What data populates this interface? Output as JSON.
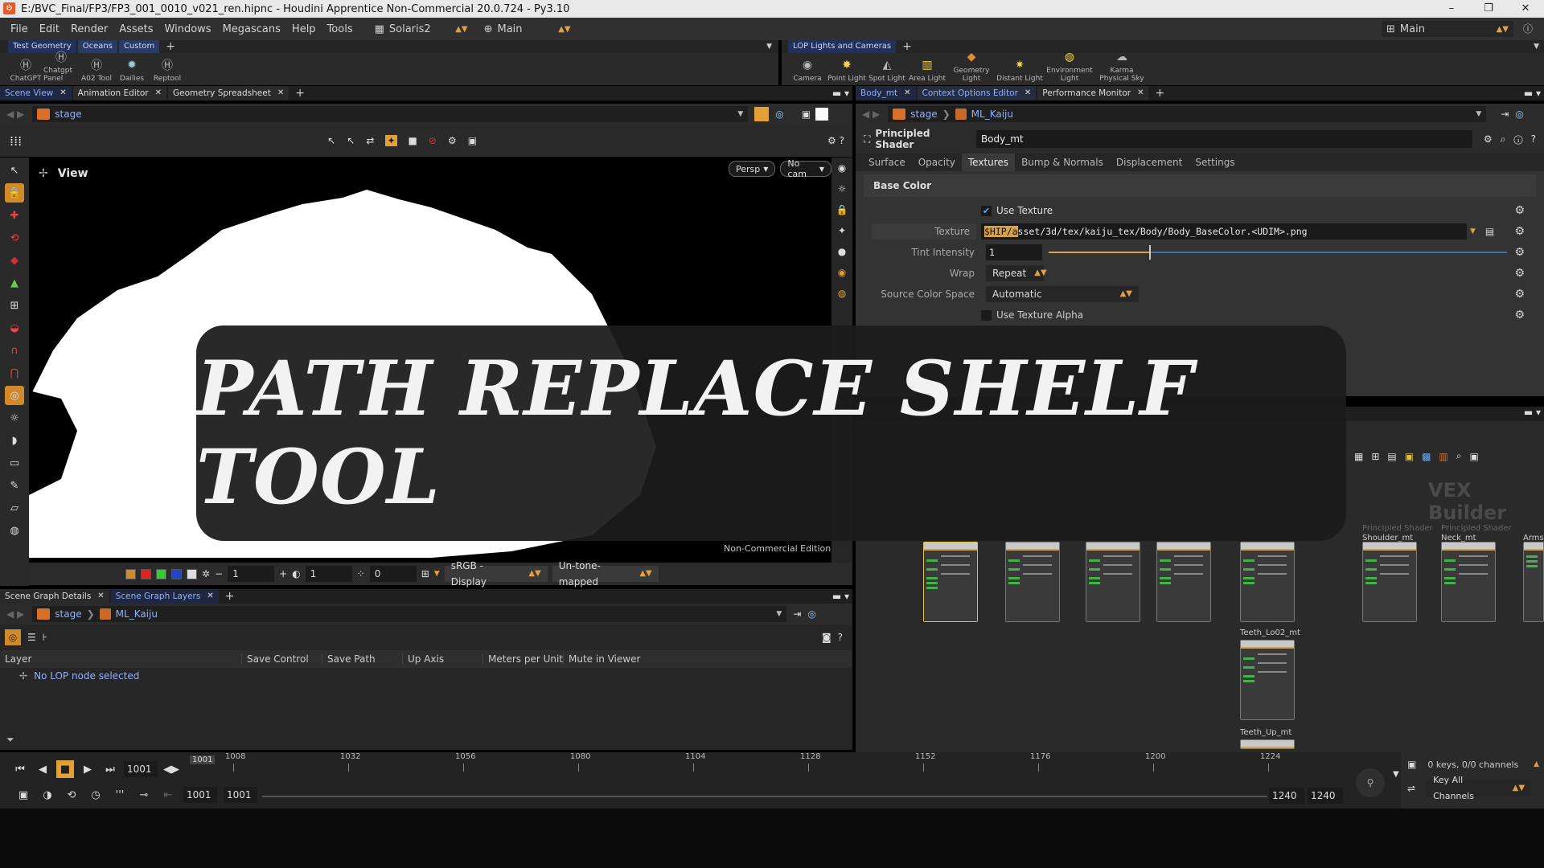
{
  "window": {
    "title": "E:/BVC_Final/FP3/FP3_001_0010_v021_ren.hipnc - Houdini Apprentice Non-Commercial 20.0.724 - Py3.10",
    "controls": [
      "–",
      "❐",
      "✕"
    ]
  },
  "menu": {
    "items": [
      "File",
      "Edit",
      "Render",
      "Assets",
      "Windows",
      "Megascans",
      "Help",
      "Tools"
    ],
    "desktop": "Solaris2",
    "workspace": "Main",
    "right_workspace": "Main"
  },
  "shelf_left": {
    "tabs": [
      "Test Geometry",
      "Oceans",
      "Custom"
    ],
    "tools": [
      "ChatGPT",
      "Chatgpt Panel",
      "A02 Tool",
      "Dailies",
      "Reptool"
    ]
  },
  "shelf_right": {
    "tabs": [
      "LOP Lights and Cameras"
    ],
    "tools": [
      "Camera",
      "Point Light",
      "Spot Light",
      "Area Light",
      "Geometry Light",
      "Distant Light",
      "Environment Light",
      "Karma Physical Sky"
    ]
  },
  "left_pane": {
    "tabs": [
      "Scene View",
      "Animation Editor",
      "Geometry Spreadsheet"
    ],
    "path": "stage",
    "view_label": "View",
    "persp_btn": "Persp",
    "cam_btn": "No cam",
    "watermark": "Non-Commercial Edition",
    "footer": {
      "a": "1",
      "b": "1",
      "c": "0",
      "colorspace": "sRGB - Display",
      "tonemap": "Un-tone-mapped"
    }
  },
  "overlay_title": "PATH REPLACE SHELF TOOL",
  "scene_graph": {
    "tabs": [
      "Scene Graph Details",
      "Scene Graph Layers"
    ],
    "path": [
      "stage",
      "ML_Kaiju"
    ],
    "columns": [
      "Layer",
      "Save Control",
      "Save Path",
      "Up Axis",
      "Meters per Unit",
      "Mute in Viewer"
    ],
    "message": "No LOP node selected"
  },
  "right_pane": {
    "tabs": [
      "Body_mt",
      "Context Options Editor",
      "Performance Monitor"
    ],
    "path": [
      "stage",
      "ML_Kaiju"
    ],
    "node_type": "Principled Shader",
    "node_name": "Body_mt",
    "param_tabs": [
      "Surface",
      "Opacity",
      "Textures",
      "Bump & Normals",
      "Displacement",
      "Settings"
    ],
    "active_tab": "Textures",
    "section": "Base Color",
    "use_texture": "Use Texture",
    "texture_label": "Texture",
    "texture_highlight": "$HIP/a",
    "texture_value": "sset/3d/tex/kaiju_tex/Body/Body_BaseColor.<UDIM>.png",
    "tint_label": "Tint Intensity",
    "tint_value": "1",
    "tint_level": 0.22,
    "wrap_label": "Wrap",
    "wrap_value": "Repeat",
    "colorspace_label": "Source Color Space",
    "colorspace_value": "Automatic",
    "alpha_label": "Use Texture Alpha"
  },
  "network": {
    "title": "VEX Builder",
    "nodes": [
      "Teeth_Lo02_mt",
      "Teeth_Up_mt",
      "Shoulder_mt",
      "Neck_mt",
      "Arms_"
    ],
    "ghost_labels": [
      "Principled Shader",
      "Principled Shader"
    ]
  },
  "timeline": {
    "current_frame": "1001",
    "ticks": [
      "1008",
      "1032",
      "1056",
      "1080",
      "1104",
      "1128",
      "1152",
      "1176",
      "1200",
      "1224"
    ],
    "marker": "1001",
    "start": "1001",
    "start2": "1001",
    "end": "1240",
    "end2": "1240",
    "keys": "0 keys, 0/0 channels",
    "key_all": "Key All Channels"
  }
}
